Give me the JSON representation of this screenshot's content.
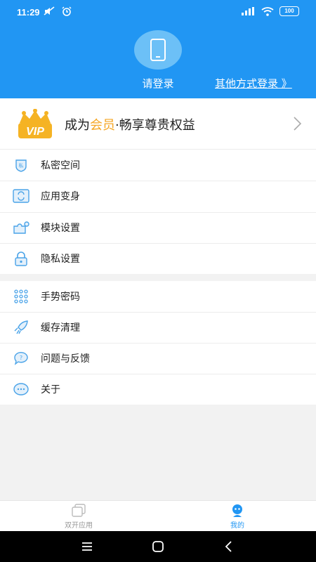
{
  "status_bar": {
    "time": "11:29",
    "battery": "100"
  },
  "header": {
    "login_label": "请登录",
    "other_login_label": "其他方式登录 》"
  },
  "vip": {
    "badge_text": "VIP",
    "text_prefix": "成为",
    "text_accent": "会员",
    "text_suffix": "·畅享尊贵权益",
    "accent_color": "#f5a623"
  },
  "menu_section_1": [
    {
      "label": "私密空间",
      "icon": "shield-icon"
    },
    {
      "label": "应用变身",
      "icon": "transform-icon"
    },
    {
      "label": "模块设置",
      "icon": "puzzle-icon"
    },
    {
      "label": "隐私设置",
      "icon": "lock-icon"
    }
  ],
  "menu_section_2": [
    {
      "label": "手势密码",
      "icon": "gesture-dots-icon"
    },
    {
      "label": "缓存清理",
      "icon": "rocket-icon"
    },
    {
      "label": "问题与反馈",
      "icon": "feedback-icon"
    },
    {
      "label": "关于",
      "icon": "info-bubble-icon"
    }
  ],
  "bottom_nav": {
    "tabs": [
      {
        "label": "双开应用",
        "icon": "dual-apps-icon",
        "active": false
      },
      {
        "label": "我的",
        "icon": "profile-icon",
        "active": true
      }
    ]
  },
  "colors": {
    "primary": "#2196f3",
    "avatar_bg": "#6cc0f7",
    "vip_gold": "#f5a623"
  }
}
